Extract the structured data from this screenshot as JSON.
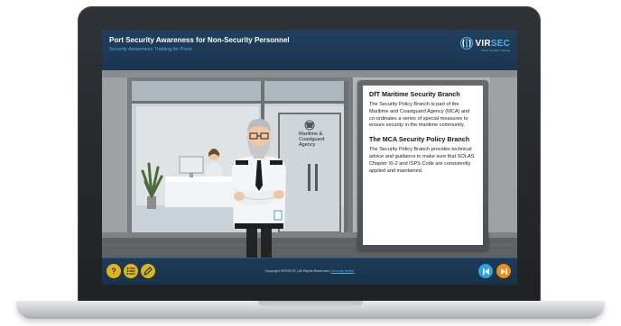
{
  "header": {
    "title": "Port Security Awareness for Non-Security Personnel",
    "subtitle": "Security Awareness Training for Ports",
    "logo_text_a": "VIR",
    "logo_text_b": "SEC",
    "logo_tagline": "Online Security Training"
  },
  "scene": {
    "door_sign_line1": "Maritime &",
    "door_sign_line2": "Coastguard",
    "door_sign_line3": "Agency"
  },
  "card": {
    "heading1": "DfT Maritime Security Branch",
    "para1": "The Security Policy Branch is part of the Maritime and Coastguard Agency (MCA) and co-ordinates a series of special measures to ensure security in the maritime community.",
    "heading2": "The MCA Security Policy Branch",
    "para2": "The Security Policy Branch provides technical advice and guidance to make sure that SOLAS Chapter XI-2 and ISPS Code are consistently applied and maintained."
  },
  "footer": {
    "copyright": "Copyright VIRSEC® | All Rights Reserved |",
    "link": "Security Notice",
    "help_glyph": "?",
    "prev_glyph": "K",
    "next_glyph": "→"
  },
  "colors": {
    "screen_bg": "#1d3b58",
    "accent_blue": "#4fb2e8",
    "button_yellow": "#e0b317",
    "button_orange": "#f08c1a",
    "button_blue": "#2fa4dc"
  },
  "icons": {
    "help": "question-icon",
    "menu": "list-icon",
    "notes": "pencil-icon",
    "prev": "skip-back-icon",
    "next": "forward-icon"
  }
}
